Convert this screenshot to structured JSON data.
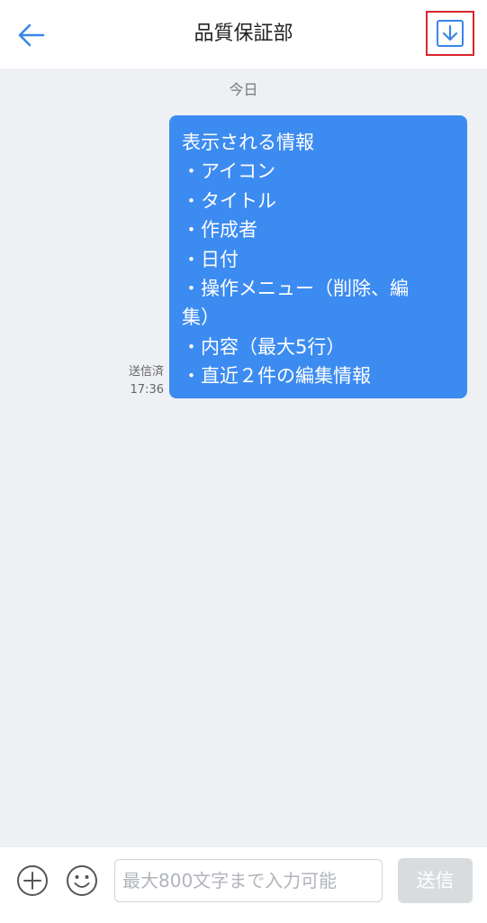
{
  "header": {
    "title": "品質保証部"
  },
  "icons": {
    "back": "arrow-left-icon",
    "download": "download-icon",
    "add": "plus-circle-icon",
    "emoji": "smiley-icon"
  },
  "colors": {
    "accent": "#3a86e8",
    "bubble": "#3c8bf0",
    "highlight_border": "#d9262c",
    "background": "#eef0f4"
  },
  "chat": {
    "date_divider": "今日",
    "message": {
      "lines": [
        "表示される情報",
        "・アイコン",
        "・タイトル",
        "・作成者",
        "・日付",
        "・操作メニュー（削除、編",
        "集）",
        "・内容（最大5行）",
        "・直近２件の編集情報"
      ],
      "status": "送信済",
      "time": "17:36"
    }
  },
  "input": {
    "placeholder": "最大800文字まで入力可能",
    "value": "",
    "send_label": "送信"
  }
}
